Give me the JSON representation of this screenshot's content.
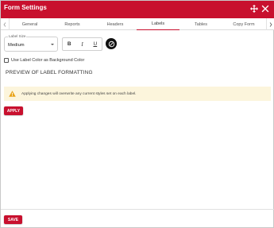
{
  "window": {
    "title": "Form Settings",
    "accent_color": "#c8102e"
  },
  "tabs": [
    {
      "label": "General"
    },
    {
      "label": "Reports"
    },
    {
      "label": "Headers"
    },
    {
      "label": "Labels",
      "active": true
    },
    {
      "label": "Tables"
    },
    {
      "label": "Copy Form"
    }
  ],
  "label_size": {
    "legend": "Label Size",
    "value": "Medium"
  },
  "formatting": {
    "bold": "B",
    "italic": "I",
    "underline": "U",
    "color_icon": "palette-icon"
  },
  "checkbox": {
    "label": "Use Label Color as Background Color",
    "checked": false
  },
  "preview": {
    "title": "PREVIEW OF LABEL FORMATTING"
  },
  "warning": {
    "message": "Applying changes will overwrite any current styles set on each label.",
    "color": "#fcf5dc"
  },
  "buttons": {
    "apply": "APPLY",
    "save": "SAVE"
  }
}
